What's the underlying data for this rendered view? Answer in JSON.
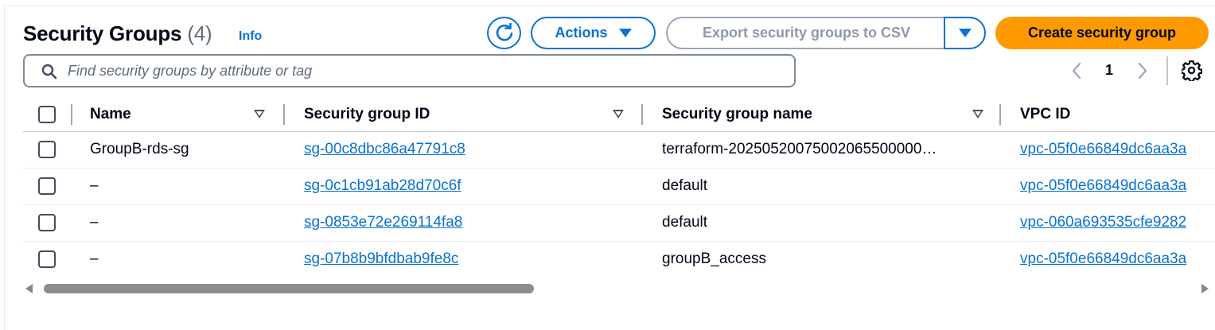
{
  "header": {
    "title": "Security Groups",
    "count": "(4)",
    "info_label": "Info"
  },
  "toolbar": {
    "actions_label": "Actions",
    "export_label": "Export security groups to CSV",
    "create_label": "Create security group"
  },
  "search": {
    "placeholder": "Find security groups by attribute or tag",
    "value": ""
  },
  "pagination": {
    "current_page": "1"
  },
  "table": {
    "columns": [
      {
        "label": "Name"
      },
      {
        "label": "Security group ID"
      },
      {
        "label": "Security group name"
      },
      {
        "label": "VPC ID"
      }
    ],
    "rows": [
      {
        "name": "GroupB-rds-sg",
        "sg_id": "sg-00c8dbc86a47791c8",
        "sg_name": "terraform-20250520075002065500000…",
        "vpc_id": "vpc-05f0e66849dc6aa3a"
      },
      {
        "name": "–",
        "sg_id": "sg-0c1cb91ab28d70c6f",
        "sg_name": "default",
        "vpc_id": "vpc-05f0e66849dc6aa3a"
      },
      {
        "name": "–",
        "sg_id": "sg-0853e72e269114fa8",
        "sg_name": "default",
        "vpc_id": "vpc-060a693535cfe9282"
      },
      {
        "name": "–",
        "sg_id": "sg-07b8b9bfdbab9fe8c",
        "sg_name": "groupB_access",
        "vpc_id": "vpc-05f0e66849dc6aa3a"
      }
    ]
  },
  "colors": {
    "primary_link": "#0972d3",
    "create_button": "#ff9900",
    "text": "#000716",
    "muted": "#5f6b7a"
  },
  "icons": {
    "refresh": "refresh-icon",
    "search": "search-icon",
    "settings": "gear-icon",
    "prev": "chevron-left-icon",
    "next": "chevron-right-icon",
    "dropdown": "caret-down-icon"
  }
}
